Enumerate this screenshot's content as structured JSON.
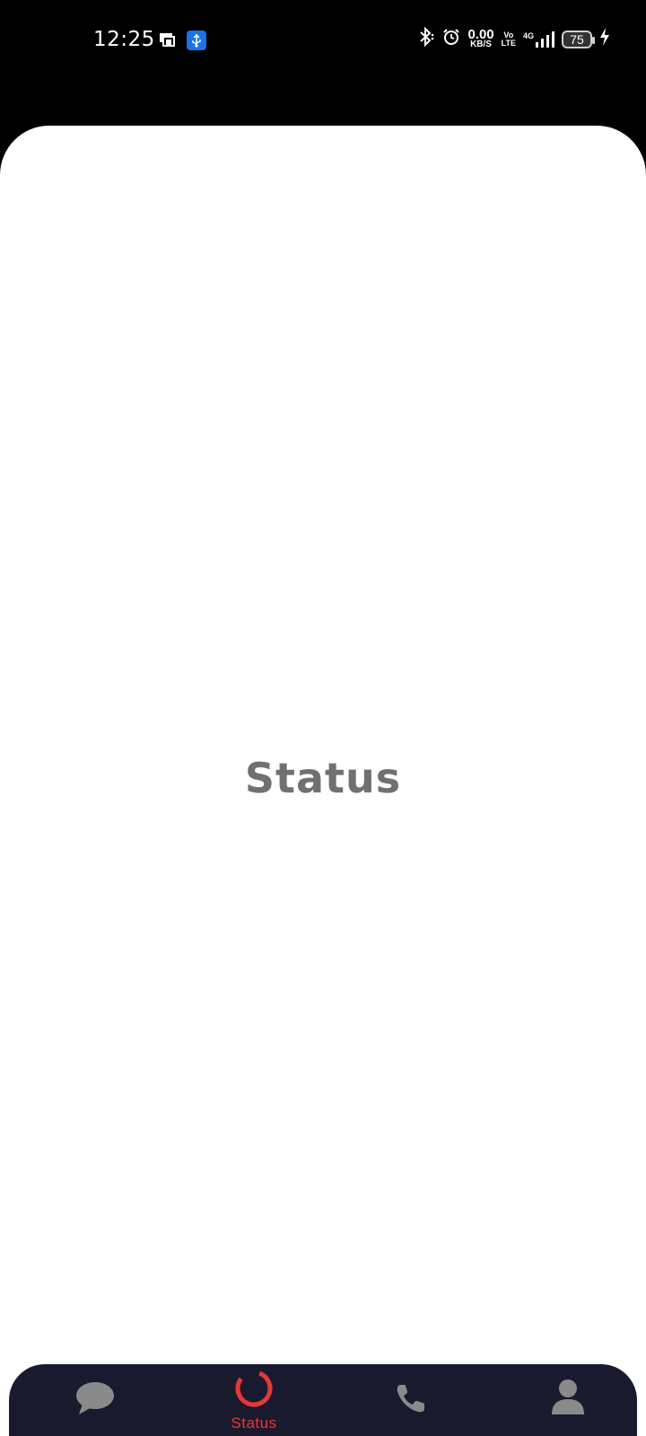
{
  "status_bar": {
    "time": "12:25",
    "speed_value": "0.00",
    "speed_unit": "KB/S",
    "volte_top": "Vo",
    "volte_bottom": "LTE",
    "network": "4G",
    "battery": "75"
  },
  "main": {
    "title": "Status"
  },
  "bottom_nav": {
    "items": [
      {
        "icon": "chat-icon",
        "label": "",
        "active": false
      },
      {
        "icon": "status-icon",
        "label": "Status",
        "active": true
      },
      {
        "icon": "phone-icon",
        "label": "",
        "active": false
      },
      {
        "icon": "profile-icon",
        "label": "",
        "active": false
      }
    ]
  },
  "colors": {
    "accent": "#e53935",
    "nav_background": "#1a1a2e",
    "inactive_icon": "#8a8a8a",
    "title_text": "#707070"
  }
}
